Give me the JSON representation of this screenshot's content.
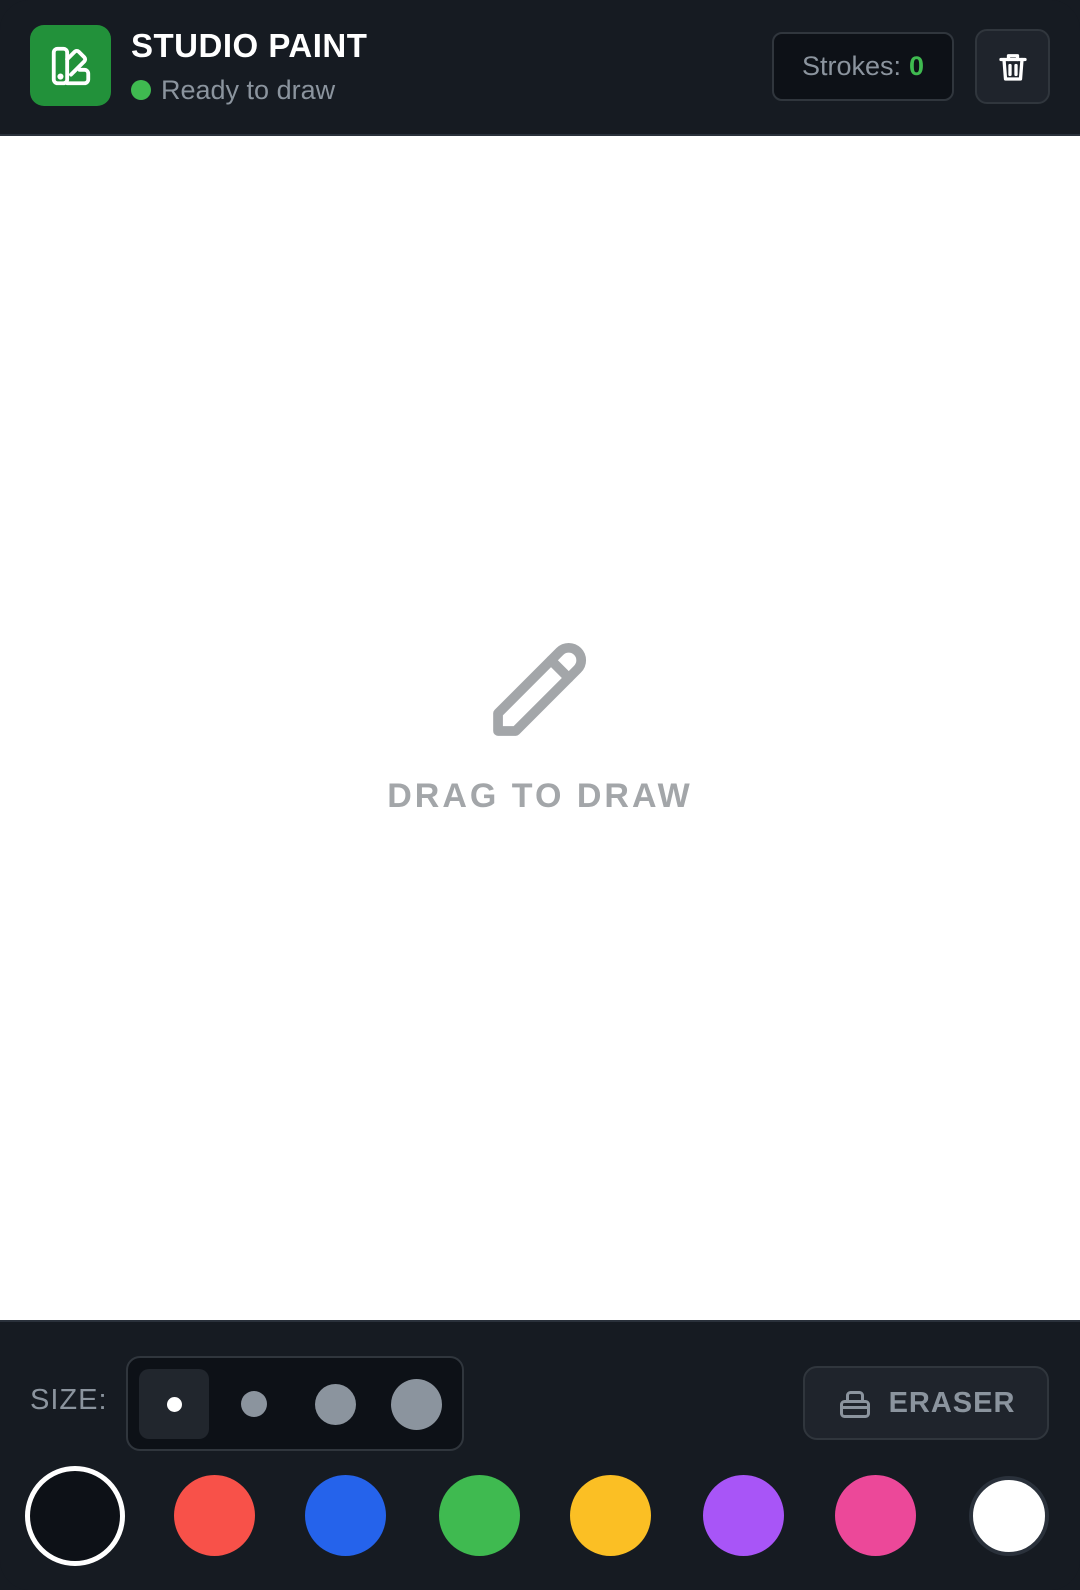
{
  "header": {
    "title": "STUDIO PAINT",
    "status_text": "Ready to draw",
    "strokes_label": "Strokes:",
    "strokes_count": "0",
    "logo_icon": "palette-swatch-icon",
    "clear_icon": "trash-icon"
  },
  "canvas": {
    "hint_icon": "pencil-icon",
    "hint_text": "DRAG TO DRAW"
  },
  "toolbar": {
    "size_label": "SIZE:",
    "brush_sizes": [
      {
        "name": "size-small",
        "selected": true
      },
      {
        "name": "size-medium",
        "selected": false
      },
      {
        "name": "size-large",
        "selected": false
      },
      {
        "name": "size-xlarge",
        "selected": false
      }
    ],
    "eraser_label": "ERASER",
    "eraser_icon": "eraser-icon",
    "colors": [
      {
        "name": "black",
        "hex": "#0d1117",
        "selected": true
      },
      {
        "name": "red",
        "hex": "#f85149"
      },
      {
        "name": "blue",
        "hex": "#2563eb"
      },
      {
        "name": "green",
        "hex": "#3fba50"
      },
      {
        "name": "yellow",
        "hex": "#fbbf24"
      },
      {
        "name": "purple",
        "hex": "#a855f7"
      },
      {
        "name": "pink",
        "hex": "#ec4899"
      },
      {
        "name": "white",
        "hex": "#ffffff"
      }
    ]
  },
  "theme": {
    "background": "#161b22",
    "accent_green": "#22913a",
    "status_green": "#3fba50"
  }
}
